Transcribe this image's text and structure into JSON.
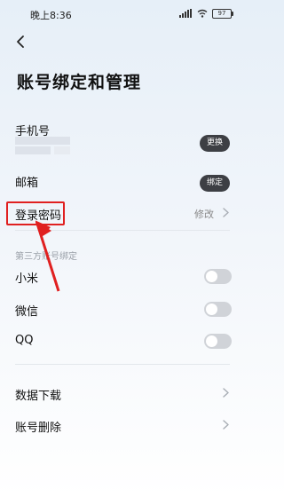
{
  "status": {
    "time": "晚上8:36",
    "battery": "97"
  },
  "header": {
    "title": "账号绑定和管理"
  },
  "phone": {
    "label": "手机号",
    "action": "更换"
  },
  "email": {
    "label": "邮箱",
    "action": "绑定"
  },
  "password": {
    "label": "登录密码",
    "action": "修改"
  },
  "third_party": {
    "title": "第三方账号绑定",
    "items": [
      {
        "label": "小米",
        "enabled": false
      },
      {
        "label": "微信",
        "enabled": false
      },
      {
        "label": "QQ",
        "enabled": false
      }
    ]
  },
  "more": {
    "items": [
      {
        "label": "数据下载"
      },
      {
        "label": "账号删除"
      }
    ]
  },
  "colors": {
    "highlight": "#e02020",
    "toggle_off": "#d0d3d8",
    "pill": "#3d3f44"
  }
}
